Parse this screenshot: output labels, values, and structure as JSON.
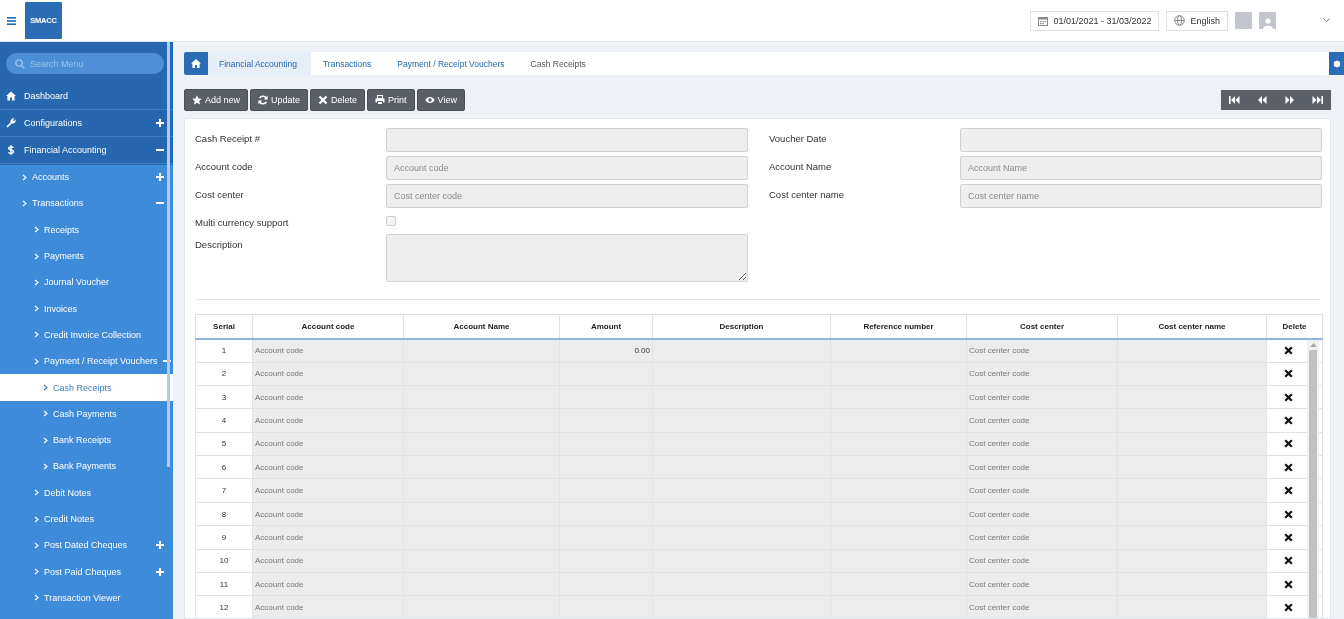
{
  "header": {
    "logo": "SMACC",
    "date_range": "01/01/2021 - 31/03/2022",
    "language": "English"
  },
  "sidebar": {
    "search": {
      "placeholder": "Search Menu"
    },
    "items": [
      {
        "label": "Dashboard",
        "selected": false
      },
      {
        "label": "Configurations",
        "selected": false,
        "expanded": false
      },
      {
        "label": "Financial Accounting",
        "selected": false,
        "expanded": true,
        "children": [
          {
            "label": "Accounts",
            "selected": false,
            "expanded": false
          },
          {
            "label": "Transactions",
            "selected": false,
            "expanded": true,
            "children": [
              {
                "label": "Receipts",
                "selected": false
              },
              {
                "label": "Payments",
                "selected": false
              },
              {
                "label": "Journal Voucher",
                "selected": false
              },
              {
                "label": "Invoices",
                "selected": false
              },
              {
                "label": "Credit Invoice Collection",
                "selected": false
              },
              {
                "label": "Payment / Receipt Vouchers",
                "selected": false,
                "expanded": true,
                "children": [
                  {
                    "label": "Cash Receipts",
                    "selected": true
                  },
                  {
                    "label": "Cash Payments",
                    "selected": false
                  },
                  {
                    "label": "Bank Receipts",
                    "selected": false
                  },
                  {
                    "label": "Bank Payments",
                    "selected": false
                  }
                ]
              },
              {
                "label": "Debit Notes",
                "selected": false
              },
              {
                "label": "Credit Notes",
                "selected": false
              },
              {
                "label": "Post Dated Cheques",
                "selected": false,
                "expanded": false
              },
              {
                "label": "Post Paid Cheques",
                "selected": false,
                "expanded": false
              },
              {
                "label": "Transaction Viewer",
                "selected": false
              }
            ]
          }
        ]
      }
    ]
  },
  "breadcrumb": [
    "Financial Accounting",
    "Transactions",
    "Payment / Receipt Vouchers",
    "Cash Receipts"
  ],
  "toolbar": [
    "Add new",
    "Update",
    "Delete",
    "Print",
    "View"
  ],
  "form": {
    "rows": [
      [
        {
          "label": "Cash Receipt #",
          "kind": "input"
        },
        {
          "label": "Voucher Date",
          "kind": "input"
        }
      ],
      [
        {
          "label": "Account code",
          "kind": "input",
          "placeholder": "Account code"
        },
        {
          "label": "Account Name",
          "kind": "input",
          "placeholder": "Account Name"
        }
      ],
      [
        {
          "label": "Cost center",
          "kind": "input",
          "placeholder": "Cost center code"
        },
        {
          "label": "Cost center name",
          "kind": "input",
          "placeholder": "Cost center name"
        }
      ],
      [
        {
          "label": "Multi currency support",
          "kind": "checkbox",
          "checked": false
        }
      ],
      [
        {
          "label": "Description",
          "kind": "textarea"
        }
      ]
    ]
  },
  "table": {
    "columns": [
      "Serial",
      "Account code",
      "Account Name",
      "Amount",
      "Description",
      "Reference number",
      "Cost center",
      "Cost center name",
      "Delete"
    ],
    "rows": [
      {
        "serial": "1",
        "account_code": {
          "placeholder": "Account code"
        },
        "amount": "0.00",
        "cost_center": {
          "placeholder": "Cost center code"
        }
      },
      {
        "serial": "2",
        "account_code": {
          "placeholder": "Account code"
        },
        "cost_center": {
          "placeholder": "Cost center code"
        }
      },
      {
        "serial": "3",
        "account_code": {
          "placeholder": "Account code"
        },
        "cost_center": {
          "placeholder": "Cost center code"
        }
      },
      {
        "serial": "4",
        "account_code": {
          "placeholder": "Account code"
        },
        "cost_center": {
          "placeholder": "Cost center code"
        }
      },
      {
        "serial": "5",
        "account_code": {
          "placeholder": "Account code"
        },
        "cost_center": {
          "placeholder": "Cost center code"
        }
      },
      {
        "serial": "6",
        "account_code": {
          "placeholder": "Account code"
        },
        "cost_center": {
          "placeholder": "Cost center code"
        }
      },
      {
        "serial": "7",
        "account_code": {
          "placeholder": "Account code"
        },
        "cost_center": {
          "placeholder": "Cost center code"
        }
      },
      {
        "serial": "8",
        "account_code": {
          "placeholder": "Account code"
        },
        "cost_center": {
          "placeholder": "Cost center code"
        }
      },
      {
        "serial": "9",
        "account_code": {
          "placeholder": "Account code"
        },
        "cost_center": {
          "placeholder": "Cost center code"
        }
      },
      {
        "serial": "10",
        "account_code": {
          "placeholder": "Account code"
        },
        "cost_center": {
          "placeholder": "Cost center code"
        }
      },
      {
        "serial": "11",
        "account_code": {
          "placeholder": "Account code"
        },
        "cost_center": {
          "placeholder": "Cost center code"
        }
      },
      {
        "serial": "12",
        "account_code": {
          "placeholder": "Account code"
        },
        "cost_center": {
          "placeholder": "Cost center code"
        }
      }
    ]
  }
}
